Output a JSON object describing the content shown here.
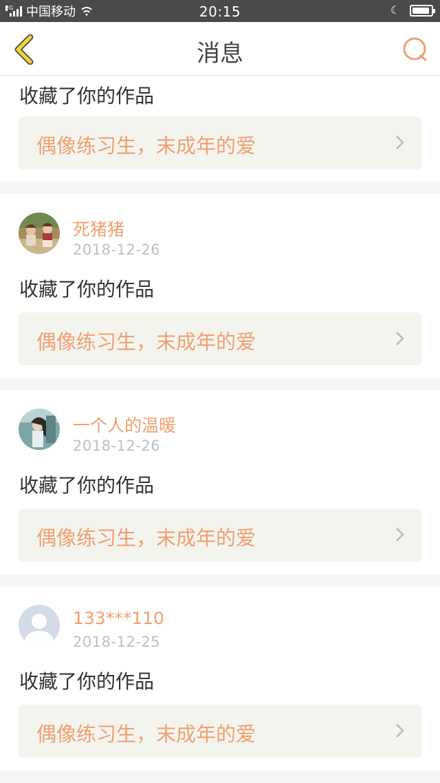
{
  "status_bar": {
    "network_tag": "2G",
    "carrier": "中国移动",
    "time": "20:15",
    "moon_icon": "moon-icon",
    "battery_level": 0.85
  },
  "header": {
    "title": "消息",
    "back_icon": "chevron-left-icon",
    "search_icon": "search-icon",
    "accent_color": "#f4d630",
    "search_color": "#f0a070"
  },
  "messages": [
    {
      "action": "收藏了你的作品",
      "work_title": "偶像练习生，末成年的爱"
    },
    {
      "username": "死猪猪",
      "date": "2018-12-26",
      "action": "收藏了你的作品",
      "work_title": "偶像练习生，末成年的爱"
    },
    {
      "username": "一个人的温暖",
      "date": "2018-12-26",
      "action": "收藏了你的作品",
      "work_title": "偶像练习生，末成年的爱"
    },
    {
      "username": "133***110",
      "date": "2018-12-25",
      "action": "收藏了你的作品",
      "work_title": "偶像练习生，末成年的爱"
    }
  ],
  "colors": {
    "username": "#f0a070",
    "date": "#c0c0c0",
    "work_bg": "#f4f4ef",
    "divider": "#f5f5f5"
  }
}
